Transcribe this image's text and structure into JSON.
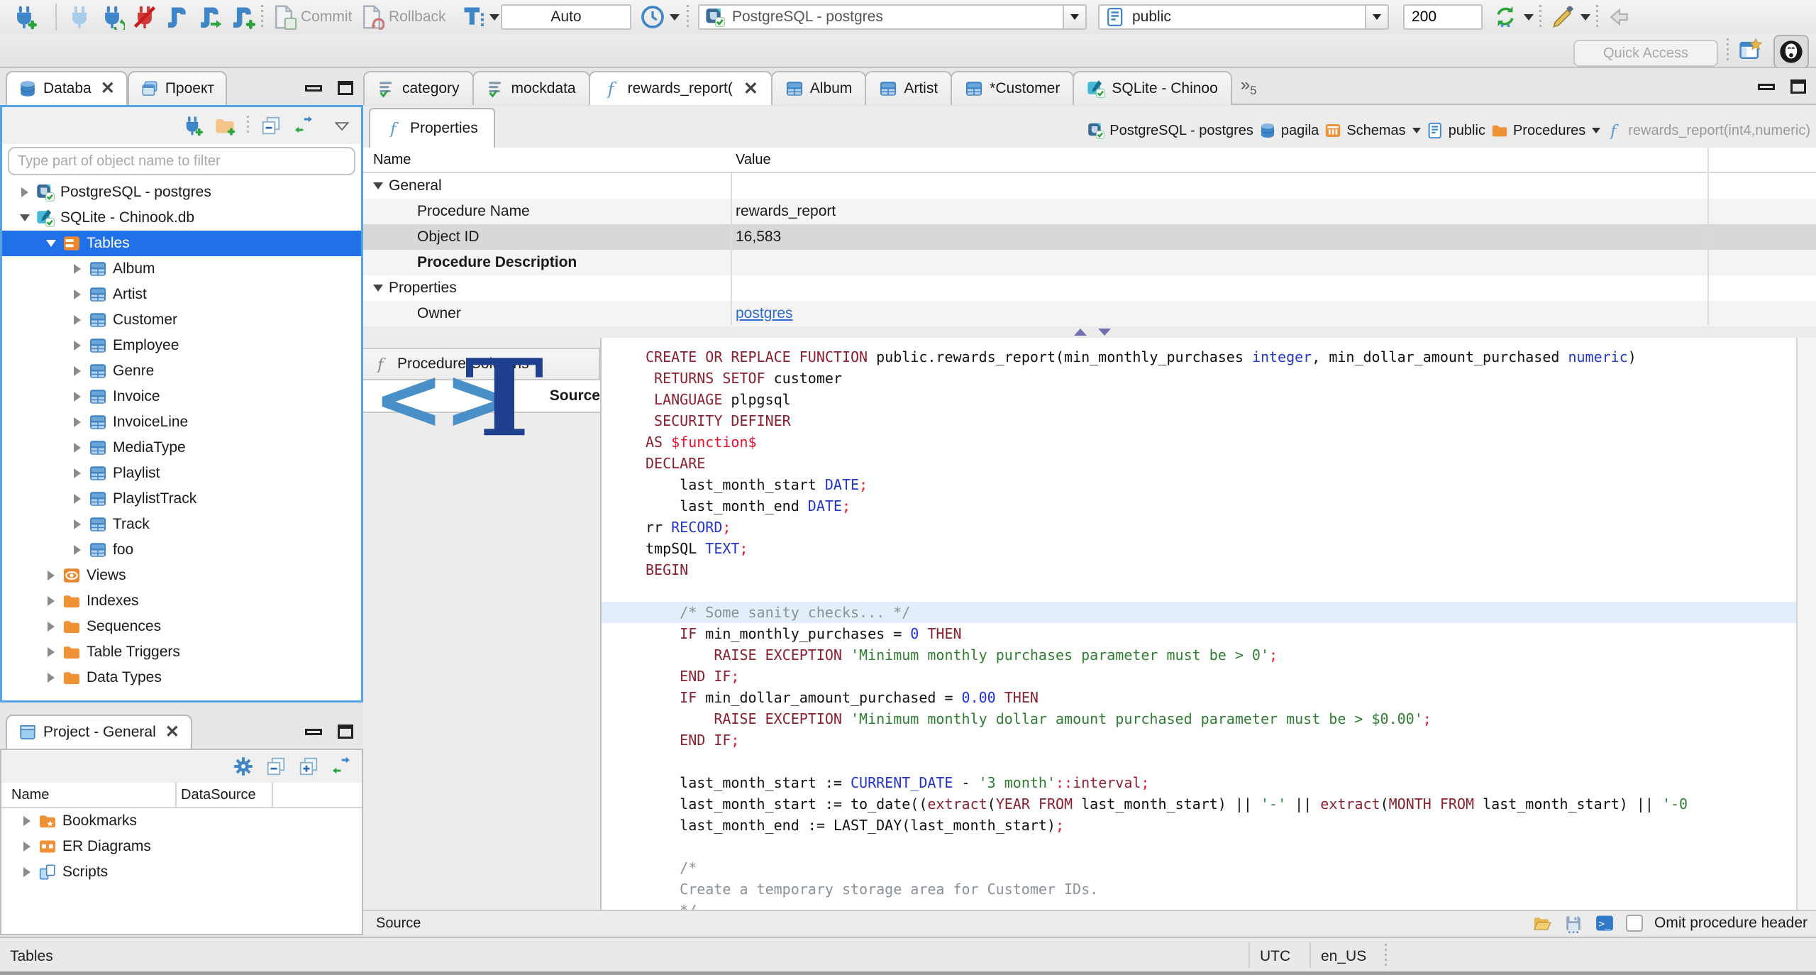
{
  "colors": {
    "selection": "#2070e8",
    "focus": "#55a3e8",
    "link": "#2f6bd0",
    "kw": "#8b2030",
    "ty": "#2336c8",
    "num": "#1b2ee8",
    "str": "#2f7e32",
    "com": "#8a9198",
    "pun": "#e8132c",
    "dollar": "#e8132c",
    "hl": "#e3eefb"
  },
  "toolbar": {
    "commit": "Commit",
    "rollback": "Rollback",
    "auto": "Auto",
    "connection": "PostgreSQL - postgres",
    "schema": "public",
    "fetch_size": "200",
    "quick_access": "Quick Access"
  },
  "navigator": {
    "tab_database": "Databa",
    "tab_project": "Проект",
    "filter_placeholder": "Type part of object name to filter",
    "tree": [
      {
        "icon": "pg",
        "label": "PostgreSQL - postgres",
        "lvl": 0,
        "state": "closed"
      },
      {
        "icon": "sqlite",
        "label": "SQLite - Chinook.db",
        "lvl": 0,
        "state": "open"
      },
      {
        "icon": "tables",
        "label": "Tables",
        "lvl": 1,
        "state": "open",
        "selected": true
      },
      {
        "icon": "table",
        "label": "Album",
        "lvl": 2,
        "state": "closed"
      },
      {
        "icon": "table",
        "label": "Artist",
        "lvl": 2,
        "state": "closed"
      },
      {
        "icon": "table",
        "label": "Customer",
        "lvl": 2,
        "state": "closed"
      },
      {
        "icon": "table",
        "label": "Employee",
        "lvl": 2,
        "state": "closed"
      },
      {
        "icon": "table",
        "label": "Genre",
        "lvl": 2,
        "state": "closed"
      },
      {
        "icon": "table",
        "label": "Invoice",
        "lvl": 2,
        "state": "closed"
      },
      {
        "icon": "table",
        "label": "InvoiceLine",
        "lvl": 2,
        "state": "closed"
      },
      {
        "icon": "table",
        "label": "MediaType",
        "lvl": 2,
        "state": "closed"
      },
      {
        "icon": "table",
        "label": "Playlist",
        "lvl": 2,
        "state": "closed"
      },
      {
        "icon": "table",
        "label": "PlaylistTrack",
        "lvl": 2,
        "state": "closed"
      },
      {
        "icon": "table",
        "label": "Track",
        "lvl": 2,
        "state": "closed"
      },
      {
        "icon": "table",
        "label": "foo",
        "lvl": 2,
        "state": "closed"
      },
      {
        "icon": "views",
        "label": "Views",
        "lvl": 1,
        "state": "closed"
      },
      {
        "icon": "folder",
        "label": "Indexes",
        "lvl": 1,
        "state": "closed"
      },
      {
        "icon": "folder",
        "label": "Sequences",
        "lvl": 1,
        "state": "closed"
      },
      {
        "icon": "folder",
        "label": "Table Triggers",
        "lvl": 1,
        "state": "closed"
      },
      {
        "icon": "folder",
        "label": "Data Types",
        "lvl": 1,
        "state": "closed"
      }
    ]
  },
  "project_panel": {
    "title": "Project - General",
    "col_name": "Name",
    "col_datasource": "DataSource",
    "tree": [
      {
        "icon": "folder-bm",
        "label": "Bookmarks"
      },
      {
        "icon": "er",
        "label": "ER Diagrams"
      },
      {
        "icon": "scripts",
        "label": "Scripts"
      }
    ]
  },
  "statusbar": {
    "left": "Tables",
    "tz": "UTC",
    "locale": "en_US"
  },
  "editor": {
    "tabs": [
      {
        "icon": "sqlfile",
        "label": "category"
      },
      {
        "icon": "sqlfile",
        "label": "mockdata"
      },
      {
        "icon": "func",
        "label": "rewards_report(",
        "active": true,
        "close": true
      },
      {
        "icon": "table",
        "label": "Album"
      },
      {
        "icon": "table",
        "label": "Artist"
      },
      {
        "icon": "table",
        "label": "*Customer"
      },
      {
        "icon": "sqlite",
        "label": "SQLite - Chinoo"
      }
    ],
    "overflow": "5",
    "properties_tab": "Properties",
    "breadcrumb": [
      {
        "icon": "pg",
        "label": "PostgreSQL - postgres"
      },
      {
        "icon": "db",
        "label": "pagila"
      },
      {
        "icon": "schemas",
        "label": "Schemas",
        "dropdown": true
      },
      {
        "icon": "schema",
        "label": "public"
      },
      {
        "icon": "folder",
        "label": "Procedures",
        "dropdown": true
      },
      {
        "icon": "func",
        "label": "rewards_report(int4,numeric)",
        "muted": true
      }
    ],
    "grid": {
      "col_name": "Name",
      "col_value": "Value",
      "rows": [
        {
          "kind": "group",
          "name": "General",
          "value": ""
        },
        {
          "kind": "item",
          "name": "Procedure Name",
          "value": "rewards_report",
          "shade": true
        },
        {
          "kind": "item",
          "name": "Object ID",
          "value": "16,583",
          "selected": true
        },
        {
          "kind": "item",
          "name": "Procedure Description",
          "value": "",
          "bold": true,
          "shade": true
        },
        {
          "kind": "group",
          "name": "Properties",
          "value": ""
        },
        {
          "kind": "item",
          "name": "Owner",
          "value": "postgres",
          "link": true,
          "shade": true
        }
      ]
    },
    "subtabs": [
      {
        "label": "Procedure Columns"
      },
      {
        "label": "Source"
      }
    ],
    "code": [
      {
        "seg": [
          [
            "kw",
            "CREATE OR REPLACE FUNCTION"
          ],
          [
            "pl",
            " public.rewards_report(min_monthly_purchases "
          ],
          [
            "ty",
            "integer"
          ],
          [
            "pl",
            ", min_dollar_amount_purchased "
          ],
          [
            "ty",
            "numeric"
          ],
          [
            "pl",
            ")"
          ]
        ]
      },
      {
        "seg": [
          [
            "pl",
            " "
          ],
          [
            "kw",
            "RETURNS SETOF"
          ],
          [
            "pl",
            " customer"
          ]
        ]
      },
      {
        "seg": [
          [
            "pl",
            " "
          ],
          [
            "kw",
            "LANGUAGE"
          ],
          [
            "pl",
            " plpgsql"
          ]
        ]
      },
      {
        "seg": [
          [
            "pl",
            " "
          ],
          [
            "kw",
            "SECURITY DEFINER"
          ]
        ]
      },
      {
        "seg": [
          [
            "kw",
            "AS"
          ],
          [
            "pl",
            " "
          ],
          [
            "dollar",
            "$function$"
          ]
        ]
      },
      {
        "seg": [
          [
            "kw",
            "DECLARE"
          ]
        ]
      },
      {
        "seg": [
          [
            "pl",
            "    last_month_start "
          ],
          [
            "ty",
            "DATE"
          ],
          [
            "pun",
            ";"
          ]
        ]
      },
      {
        "seg": [
          [
            "pl",
            "    last_month_end "
          ],
          [
            "ty",
            "DATE"
          ],
          [
            "pun",
            ";"
          ]
        ]
      },
      {
        "seg": [
          [
            "pl",
            "rr "
          ],
          [
            "ty",
            "RECORD"
          ],
          [
            "pun",
            ";"
          ]
        ]
      },
      {
        "seg": [
          [
            "pl",
            "tmpSQL "
          ],
          [
            "ty",
            "TEXT"
          ],
          [
            "pun",
            ";"
          ]
        ]
      },
      {
        "seg": [
          [
            "kw",
            "BEGIN"
          ]
        ]
      },
      {
        "seg": []
      },
      {
        "hl": true,
        "seg": [
          [
            "com",
            "    /* Some sanity checks... */"
          ]
        ]
      },
      {
        "seg": [
          [
            "pl",
            "    "
          ],
          [
            "kw",
            "IF"
          ],
          [
            "pl",
            " min_monthly_purchases = "
          ],
          [
            "num",
            "0"
          ],
          [
            "pl",
            " "
          ],
          [
            "kw",
            "THEN"
          ]
        ]
      },
      {
        "seg": [
          [
            "pl",
            "        "
          ],
          [
            "kw",
            "RAISE EXCEPTION"
          ],
          [
            "pl",
            " "
          ],
          [
            "str",
            "'Minimum monthly purchases parameter must be > 0'"
          ],
          [
            "pun",
            ";"
          ]
        ]
      },
      {
        "seg": [
          [
            "pl",
            "    "
          ],
          [
            "kw",
            "END IF"
          ],
          [
            "pun",
            ";"
          ]
        ]
      },
      {
        "seg": [
          [
            "pl",
            "    "
          ],
          [
            "kw",
            "IF"
          ],
          [
            "pl",
            " min_dollar_amount_purchased = "
          ],
          [
            "num",
            "0.00"
          ],
          [
            "pl",
            " "
          ],
          [
            "kw",
            "THEN"
          ]
        ]
      },
      {
        "seg": [
          [
            "pl",
            "        "
          ],
          [
            "kw",
            "RAISE EXCEPTION"
          ],
          [
            "pl",
            " "
          ],
          [
            "str",
            "'Minimum monthly dollar amount purchased parameter must be > $0.00'"
          ],
          [
            "pun",
            ";"
          ]
        ]
      },
      {
        "seg": [
          [
            "pl",
            "    "
          ],
          [
            "kw",
            "END IF"
          ],
          [
            "pun",
            ";"
          ]
        ]
      },
      {
        "seg": []
      },
      {
        "seg": [
          [
            "pl",
            "    last_month_start := "
          ],
          [
            "ty",
            "CURRENT_DATE"
          ],
          [
            "pl",
            " - "
          ],
          [
            "str",
            "'3 month'"
          ],
          [
            "pun",
            "::"
          ],
          [
            "kw",
            "interval"
          ],
          [
            "pun",
            ";"
          ]
        ]
      },
      {
        "seg": [
          [
            "pl",
            "    last_month_start := to_date(("
          ],
          [
            "kw",
            "extract"
          ],
          [
            "pl",
            "("
          ],
          [
            "kw",
            "YEAR FROM"
          ],
          [
            "pl",
            " last_month_start) || "
          ],
          [
            "str",
            "'-'"
          ],
          [
            "pl",
            " || "
          ],
          [
            "kw",
            "extract"
          ],
          [
            "pl",
            "("
          ],
          [
            "kw",
            "MONTH FROM"
          ],
          [
            "pl",
            " last_month_start) || "
          ],
          [
            "str",
            "'-0"
          ]
        ]
      },
      {
        "seg": [
          [
            "pl",
            "    last_month_end := LAST_DAY(last_month_start)"
          ],
          [
            "pun",
            ";"
          ]
        ]
      },
      {
        "seg": []
      },
      {
        "seg": [
          [
            "com",
            "    /*"
          ]
        ]
      },
      {
        "seg": [
          [
            "com",
            "    Create a temporary storage area for Customer IDs."
          ]
        ]
      },
      {
        "seg": [
          [
            "com",
            "    */"
          ]
        ]
      }
    ],
    "bottom": {
      "label": "Source",
      "omit": "Omit procedure header"
    }
  }
}
